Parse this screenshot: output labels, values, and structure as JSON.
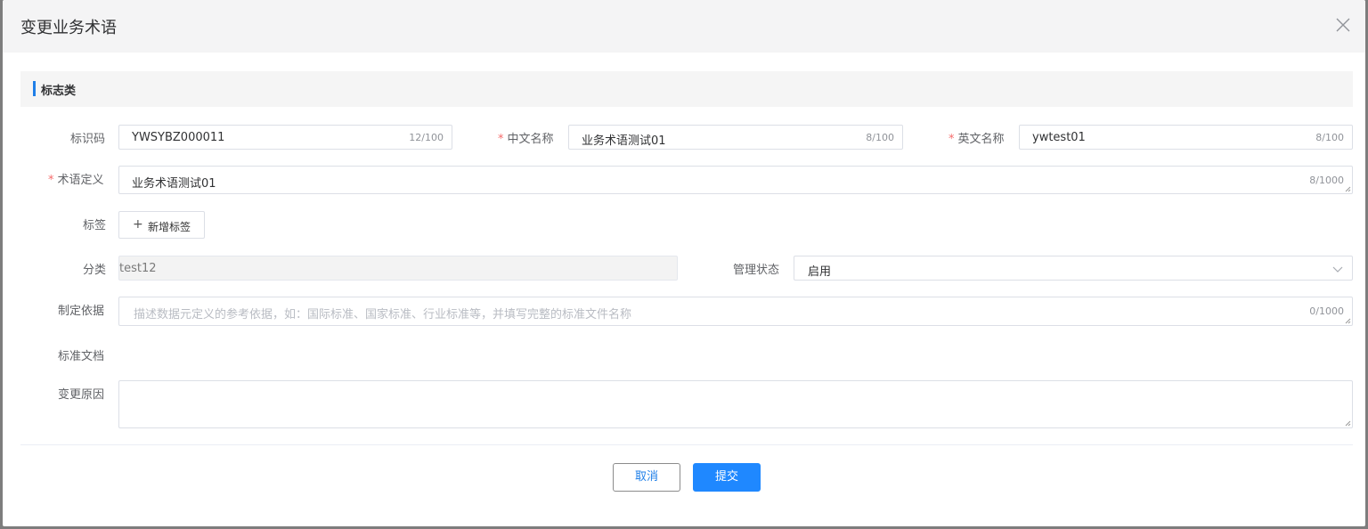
{
  "dialog": {
    "title": "变更业务术语",
    "close_icon": "close-icon"
  },
  "section": {
    "title": "标志类"
  },
  "form": {
    "code": {
      "label": "标识码",
      "value": "YWSYBZ000011",
      "count": "12/100"
    },
    "cn_name": {
      "required": "*",
      "label": "中文名称",
      "value": "业务术语测试01",
      "count": "8/100"
    },
    "en_name": {
      "required": "*",
      "label": "英文名称",
      "value": "ywtest01",
      "count": "8/100"
    },
    "definition": {
      "required": "*",
      "label": "术语定义",
      "value": "业务术语测试01",
      "count": "8/1000"
    },
    "tag": {
      "label": "标签",
      "button_icon": "+",
      "button_label": "新增标签"
    },
    "category": {
      "label": "分类",
      "value": "test12"
    },
    "status": {
      "label": "管理状态",
      "value": "启用",
      "icon": "chevron-down-icon"
    },
    "basis": {
      "label": "制定依据",
      "placeholder": "描述数据元定义的参考依据，如：国际标准、国家标准、行业标准等，并填写完整的标准文件名称",
      "count": "0/1000"
    },
    "doc": {
      "label": "标准文档"
    },
    "reason": {
      "label": "变更原因",
      "value": ""
    }
  },
  "footer": {
    "cancel_label": "取消",
    "submit_label": "提交"
  },
  "colors": {
    "primary": "#1f88ff",
    "required": "#f56c6c",
    "section_bar": "#1f7fe8"
  }
}
